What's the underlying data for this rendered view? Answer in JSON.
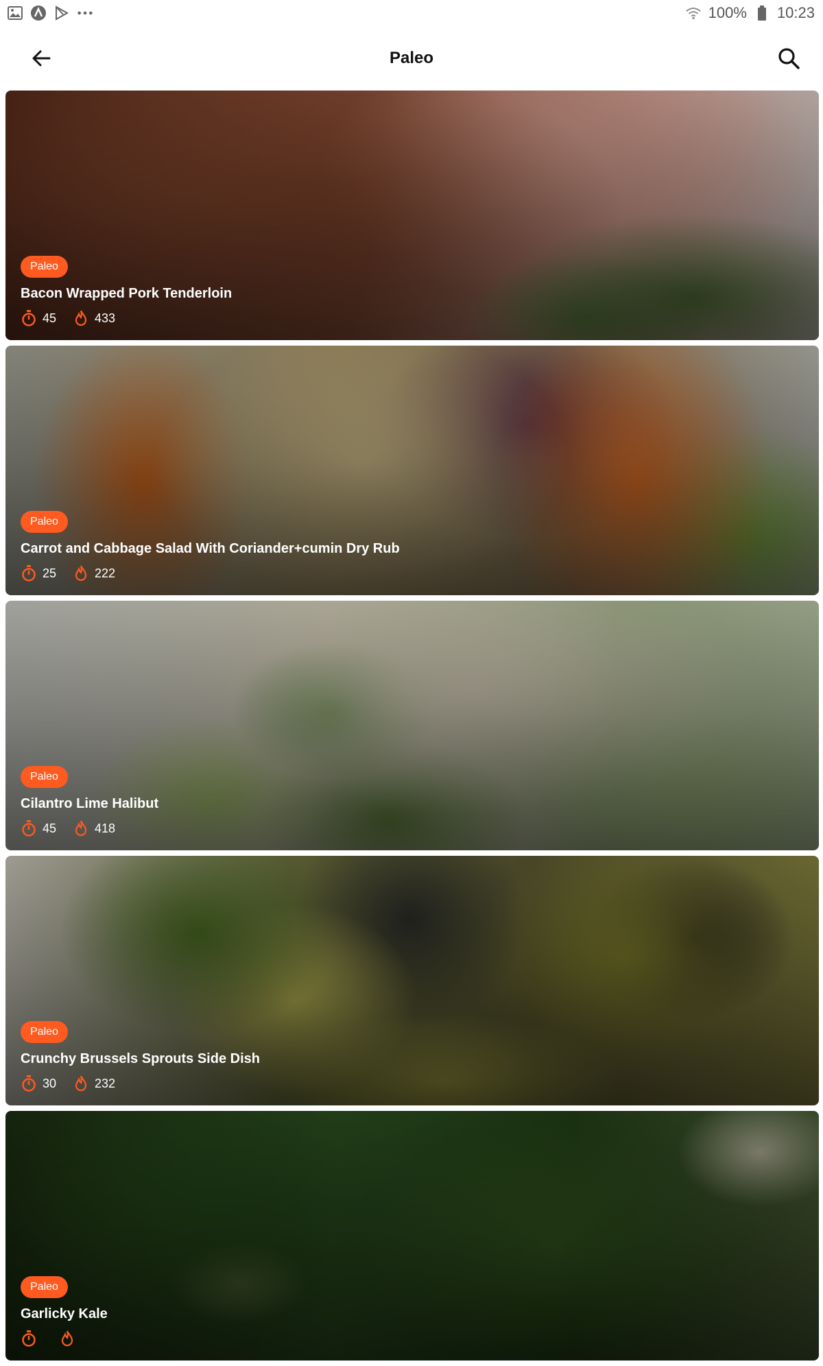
{
  "status_bar": {
    "icons": [
      "image-icon",
      "app-a-icon",
      "play-store-icon",
      "more-dots-icon"
    ],
    "battery_percent": "100%",
    "time": "10:23"
  },
  "app_bar": {
    "title": "Paleo",
    "back_icon": "arrow-left-icon",
    "search_icon": "search-icon"
  },
  "colors": {
    "accent": "#ff5a1f",
    "title_text": "#111111",
    "card_text": "#ffffff"
  },
  "recipes": [
    {
      "badge": "Paleo",
      "title": "Bacon Wrapped Pork Tenderloin",
      "time": "45",
      "calories": "433"
    },
    {
      "badge": "Paleo",
      "title": "Carrot and Cabbage Salad With Coriander+cumin Dry Rub",
      "time": "25",
      "calories": "222"
    },
    {
      "badge": "Paleo",
      "title": "Cilantro Lime Halibut",
      "time": "45",
      "calories": "418"
    },
    {
      "badge": "Paleo",
      "title": "Crunchy Brussels Sprouts Side Dish",
      "time": "30",
      "calories": "232"
    },
    {
      "badge": "Paleo",
      "title": "Garlicky Kale",
      "time": "",
      "calories": ""
    }
  ]
}
